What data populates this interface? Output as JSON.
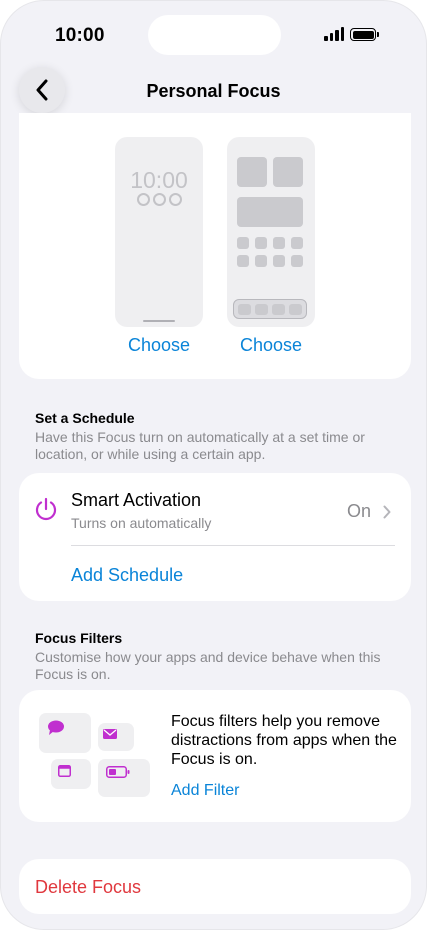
{
  "status_bar": {
    "time": "10:00"
  },
  "nav": {
    "title": "Personal Focus"
  },
  "wallpaper": {
    "lock_time": "10:00",
    "choose_lock": "Choose",
    "choose_home": "Choose"
  },
  "schedule": {
    "header": "Set a Schedule",
    "description": "Have this Focus turn on automatically at a set time or location, or while using a certain app.",
    "smart_activation": {
      "title": "Smart Activation",
      "subtitle": "Turns on automatically",
      "value": "On"
    },
    "add_schedule": "Add Schedule"
  },
  "filters": {
    "header": "Focus Filters",
    "description": "Customise how your apps and device behave when this Focus is on.",
    "body": "Focus filters help you remove distractions from apps when the Focus is on.",
    "add_filter": "Add Filter"
  },
  "delete": {
    "label": "Delete Focus"
  },
  "colors": {
    "accent": "#0a84d8",
    "focus_purple": "#c02fcf",
    "destructive": "#e0383e"
  },
  "icons": [
    "back-chevron-icon",
    "signal-icon",
    "battery-icon",
    "power-icon",
    "chevron-right-icon",
    "message-icon",
    "mail-icon",
    "calendar-icon",
    "battery-icon"
  ]
}
